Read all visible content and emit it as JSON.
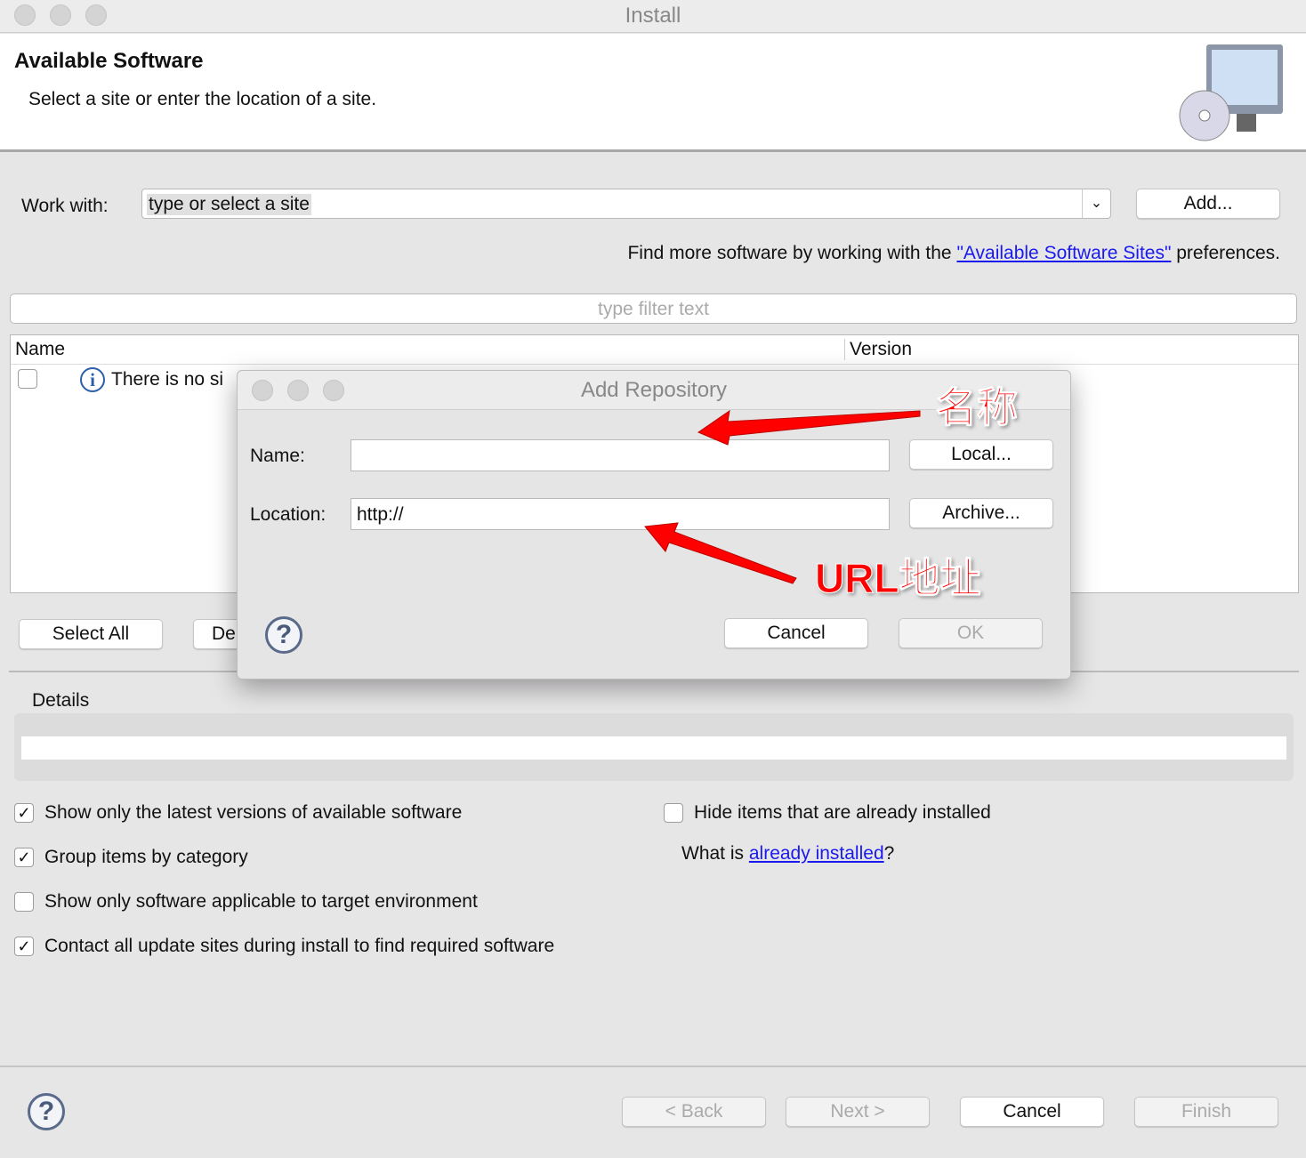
{
  "window": {
    "title": "Install"
  },
  "header": {
    "title": "Available Software",
    "subtitle": "Select a site or enter the location of a site."
  },
  "work_with": {
    "label": "Work with:",
    "value": "type or select a site",
    "add_button": "Add..."
  },
  "find_more": {
    "prefix": "Find more software by working with the ",
    "link": "\"Available Software Sites\"",
    "suffix": " preferences."
  },
  "filter": {
    "placeholder": "type filter text"
  },
  "table": {
    "columns": [
      "Name",
      "Version"
    ],
    "rows": [
      {
        "name": "There is no si",
        "checked": false
      }
    ]
  },
  "list_buttons": {
    "select_all": "Select All",
    "deselect_all": "De"
  },
  "details": {
    "label": "Details"
  },
  "options": [
    {
      "label": "Show only the latest versions of available software",
      "checked": true
    },
    {
      "label": "Group items by category",
      "checked": true
    },
    {
      "label": "Show only software applicable to target environment",
      "checked": false
    },
    {
      "label": "Contact all update sites during install to find required software",
      "checked": true
    },
    {
      "label": "Hide items that are already installed",
      "checked": false
    }
  ],
  "what_installed": {
    "prefix": "What is ",
    "link": "already installed",
    "suffix": "?"
  },
  "footer": {
    "back": "< Back",
    "next": "Next >",
    "cancel": "Cancel",
    "finish": "Finish"
  },
  "dialog": {
    "title": "Add Repository",
    "name_label": "Name:",
    "name_value": "",
    "location_label": "Location:",
    "location_value": "http://",
    "local_button": "Local...",
    "archive_button": "Archive...",
    "cancel": "Cancel",
    "ok": "OK"
  },
  "annotations": {
    "name": "名称",
    "url": "URL地址",
    "color": "#ff0000"
  }
}
